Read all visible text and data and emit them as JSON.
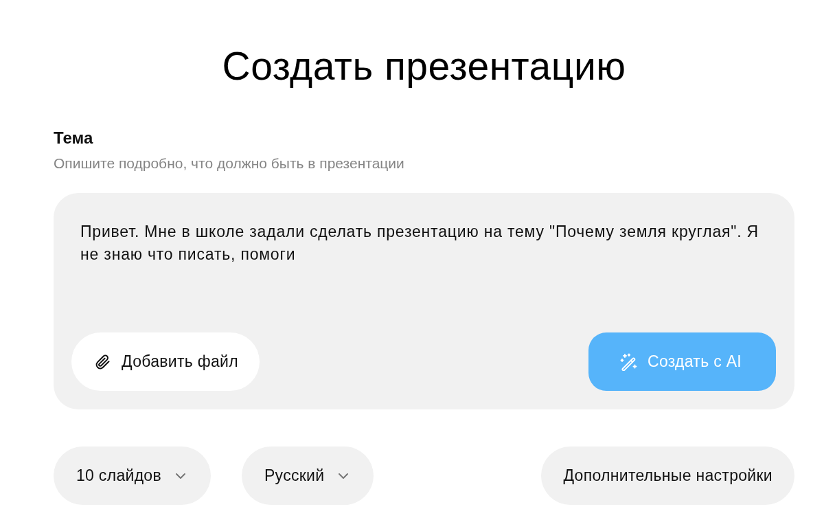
{
  "title": "Создать презентацию",
  "topic": {
    "label": "Тема",
    "hint": "Опишите подробно, что должно быть в презентации",
    "value": "Привет. Мне в школе задали сделать презентацию на тему \"Почему земля круглая\". Я не знаю что писать, помоги",
    "buttons": [
      {
        "kind": "attach",
        "label": "Добавить файл"
      },
      {
        "kind": "generate",
        "label": "Создать с AI"
      }
    ]
  },
  "options": [
    {
      "kind": "dropdown",
      "label": "10 слайдов"
    },
    {
      "kind": "dropdown",
      "label": "Русский"
    },
    {
      "kind": "button",
      "label": "Дополнительные настройки"
    }
  ]
}
